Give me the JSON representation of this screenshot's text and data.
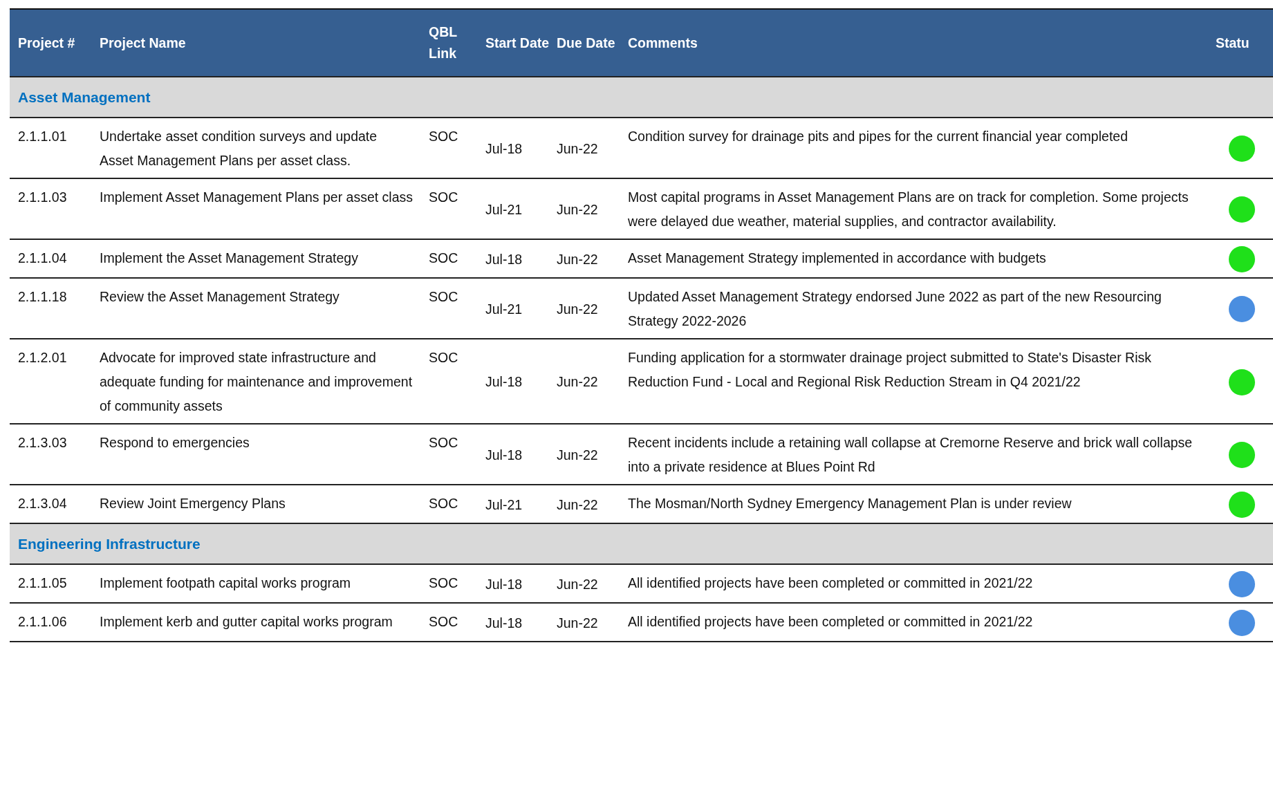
{
  "table": {
    "columns": [
      "Project #",
      "Project Name",
      "QBL Link",
      "Start Date",
      "Due Date",
      "Comments",
      "Statu"
    ],
    "groups": [
      {
        "title": "Asset Management",
        "rows": [
          {
            "project": "2.1.1.01",
            "name": "Undertake asset condition surveys and update Asset Management Plans per asset class.",
            "qbl": "SOC",
            "start": "Jul-18",
            "due": "Jun-22",
            "comments": "Condition survey for drainage pits and pipes for the current financial year completed",
            "color": "#1fe01a"
          },
          {
            "project": "2.1.1.03",
            "name": "Implement Asset Management Plans per asset class",
            "qbl": "SOC",
            "start": "Jul-21",
            "due": "Jun-22",
            "comments": "Most capital programs in Asset Management Plans are on track for completion. Some projects were delayed due weather, material supplies, and contractor availability.",
            "color": "#1fe01a"
          },
          {
            "project": "2.1.1.04",
            "name": "Implement the Asset Management Strategy",
            "qbl": "SOC",
            "start": "Jul-18",
            "due": "Jun-22",
            "comments": "Asset Management Strategy implemented in accordance with budgets",
            "color": "#1fe01a"
          },
          {
            "project": "2.1.1.18",
            "name": "Review the Asset Management Strategy",
            "qbl": "SOC",
            "start": "Jul-21",
            "due": "Jun-22",
            "comments": "Updated Asset Management Strategy endorsed June 2022 as part of the new Resourcing Strategy 2022-2026",
            "color": "#4a8ee0"
          },
          {
            "project": "2.1.2.01",
            "name": "Advocate for improved state infrastructure and adequate funding for maintenance and improvement of community assets",
            "qbl": "SOC",
            "start": "Jul-18",
            "due": "Jun-22",
            "comments": "Funding application for a stormwater drainage project submitted to State's Disaster Risk Reduction Fund - Local and Regional Risk Reduction Stream in Q4 2021/22",
            "color": "#1fe01a"
          },
          {
            "project": "2.1.3.03",
            "name": "Respond to emergencies",
            "qbl": "SOC",
            "start": "Jul-18",
            "due": "Jun-22",
            "comments": "Recent incidents include a retaining wall collapse at Cremorne Reserve and brick wall collapse into a private residence at Blues Point Rd",
            "color": "#1fe01a"
          },
          {
            "project": "2.1.3.04",
            "name": "Review Joint Emergency Plans",
            "qbl": "SOC",
            "start": "Jul-21",
            "due": "Jun-22",
            "comments": "The Mosman/North Sydney Emergency Management Plan is under review",
            "color": "#1fe01a"
          }
        ]
      },
      {
        "title": "Engineering Infrastructure",
        "rows": [
          {
            "project": "2.1.1.05",
            "name": "Implement footpath capital works program",
            "qbl": "SOC",
            "start": "Jul-18",
            "due": "Jun-22",
            "comments": "All identified projects have been completed or committed in 2021/22",
            "color": "#4a8ee0"
          },
          {
            "project": "2.1.1.06",
            "name": "Implement kerb and gutter capital works program",
            "qbl": "SOC",
            "start": "Jul-18",
            "due": "Jun-22",
            "comments": "All identified projects have been completed or committed in 2021/22",
            "color": "#4a8ee0"
          }
        ]
      }
    ]
  }
}
